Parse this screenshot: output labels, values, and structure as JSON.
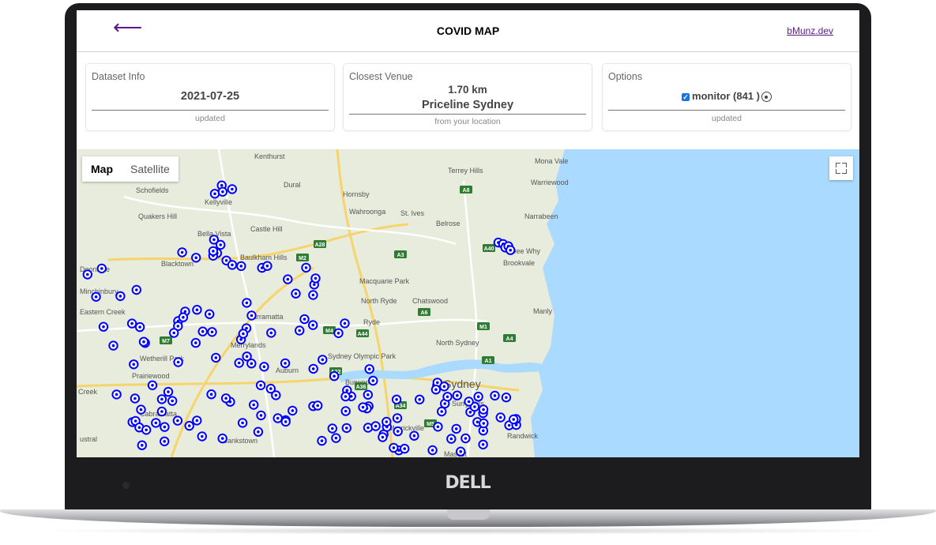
{
  "device": {
    "brand": "DELL"
  },
  "header": {
    "back_icon": "arrow-left-icon",
    "title": "COVID MAP",
    "link": "bMunz.dev"
  },
  "cards": {
    "dataset": {
      "label": "Dataset Info",
      "value": "2021-07-25",
      "sub": "updated"
    },
    "venue": {
      "label": "Closest Venue",
      "distance": "1.70 km",
      "name": "Priceline Sydney",
      "sub": "from your location"
    },
    "options": {
      "label": "Options",
      "checkbox_label": "monitor (841 )",
      "checked": true,
      "sub": "updated"
    }
  },
  "map": {
    "toggle": {
      "map": "Map",
      "satellite": "Satellite"
    },
    "fullscreen_icon": "fullscreen-icon",
    "marker_color": "#0000ff",
    "water_color": "#aadaff",
    "land_color": "#e8ecdd",
    "places": [
      "Kenthurst",
      "Mona Vale",
      "Terrey Hills",
      "Warriewood",
      "Dural",
      "Schofields",
      "Hornsby",
      "Kellyville",
      "Wahroonga",
      "St. Ives",
      "Quakers Hill",
      "Narrabeen",
      "Castle Hill",
      "Belrose",
      "Bella Vista",
      "Dee Why",
      "Baulkham Hills",
      "Brookvale",
      "Blacktown",
      "Macquarie Park",
      "Minchinbury",
      "North Ryde",
      "Chatswood",
      "Eastern Creek",
      "Manly",
      "Parramatta",
      "Ryde",
      "North Sydney",
      "Merrylands",
      "Sydney Olympic Park",
      "Wetherill Park",
      "Auburn",
      "Prairiewood",
      "Burwood",
      "Sydney",
      "Surry Hills",
      "Cabramatta",
      "Marrickville",
      "Randwick",
      "Bankstown",
      "Mascot",
      "Creek",
      "ustral",
      "Doonside"
    ],
    "roads": [
      "M7",
      "M2",
      "A28",
      "A3",
      "A8",
      "A40",
      "A6",
      "M4",
      "A44",
      "M1",
      "A4",
      "A22",
      "A36",
      "A34",
      "M5",
      "A1"
    ]
  }
}
